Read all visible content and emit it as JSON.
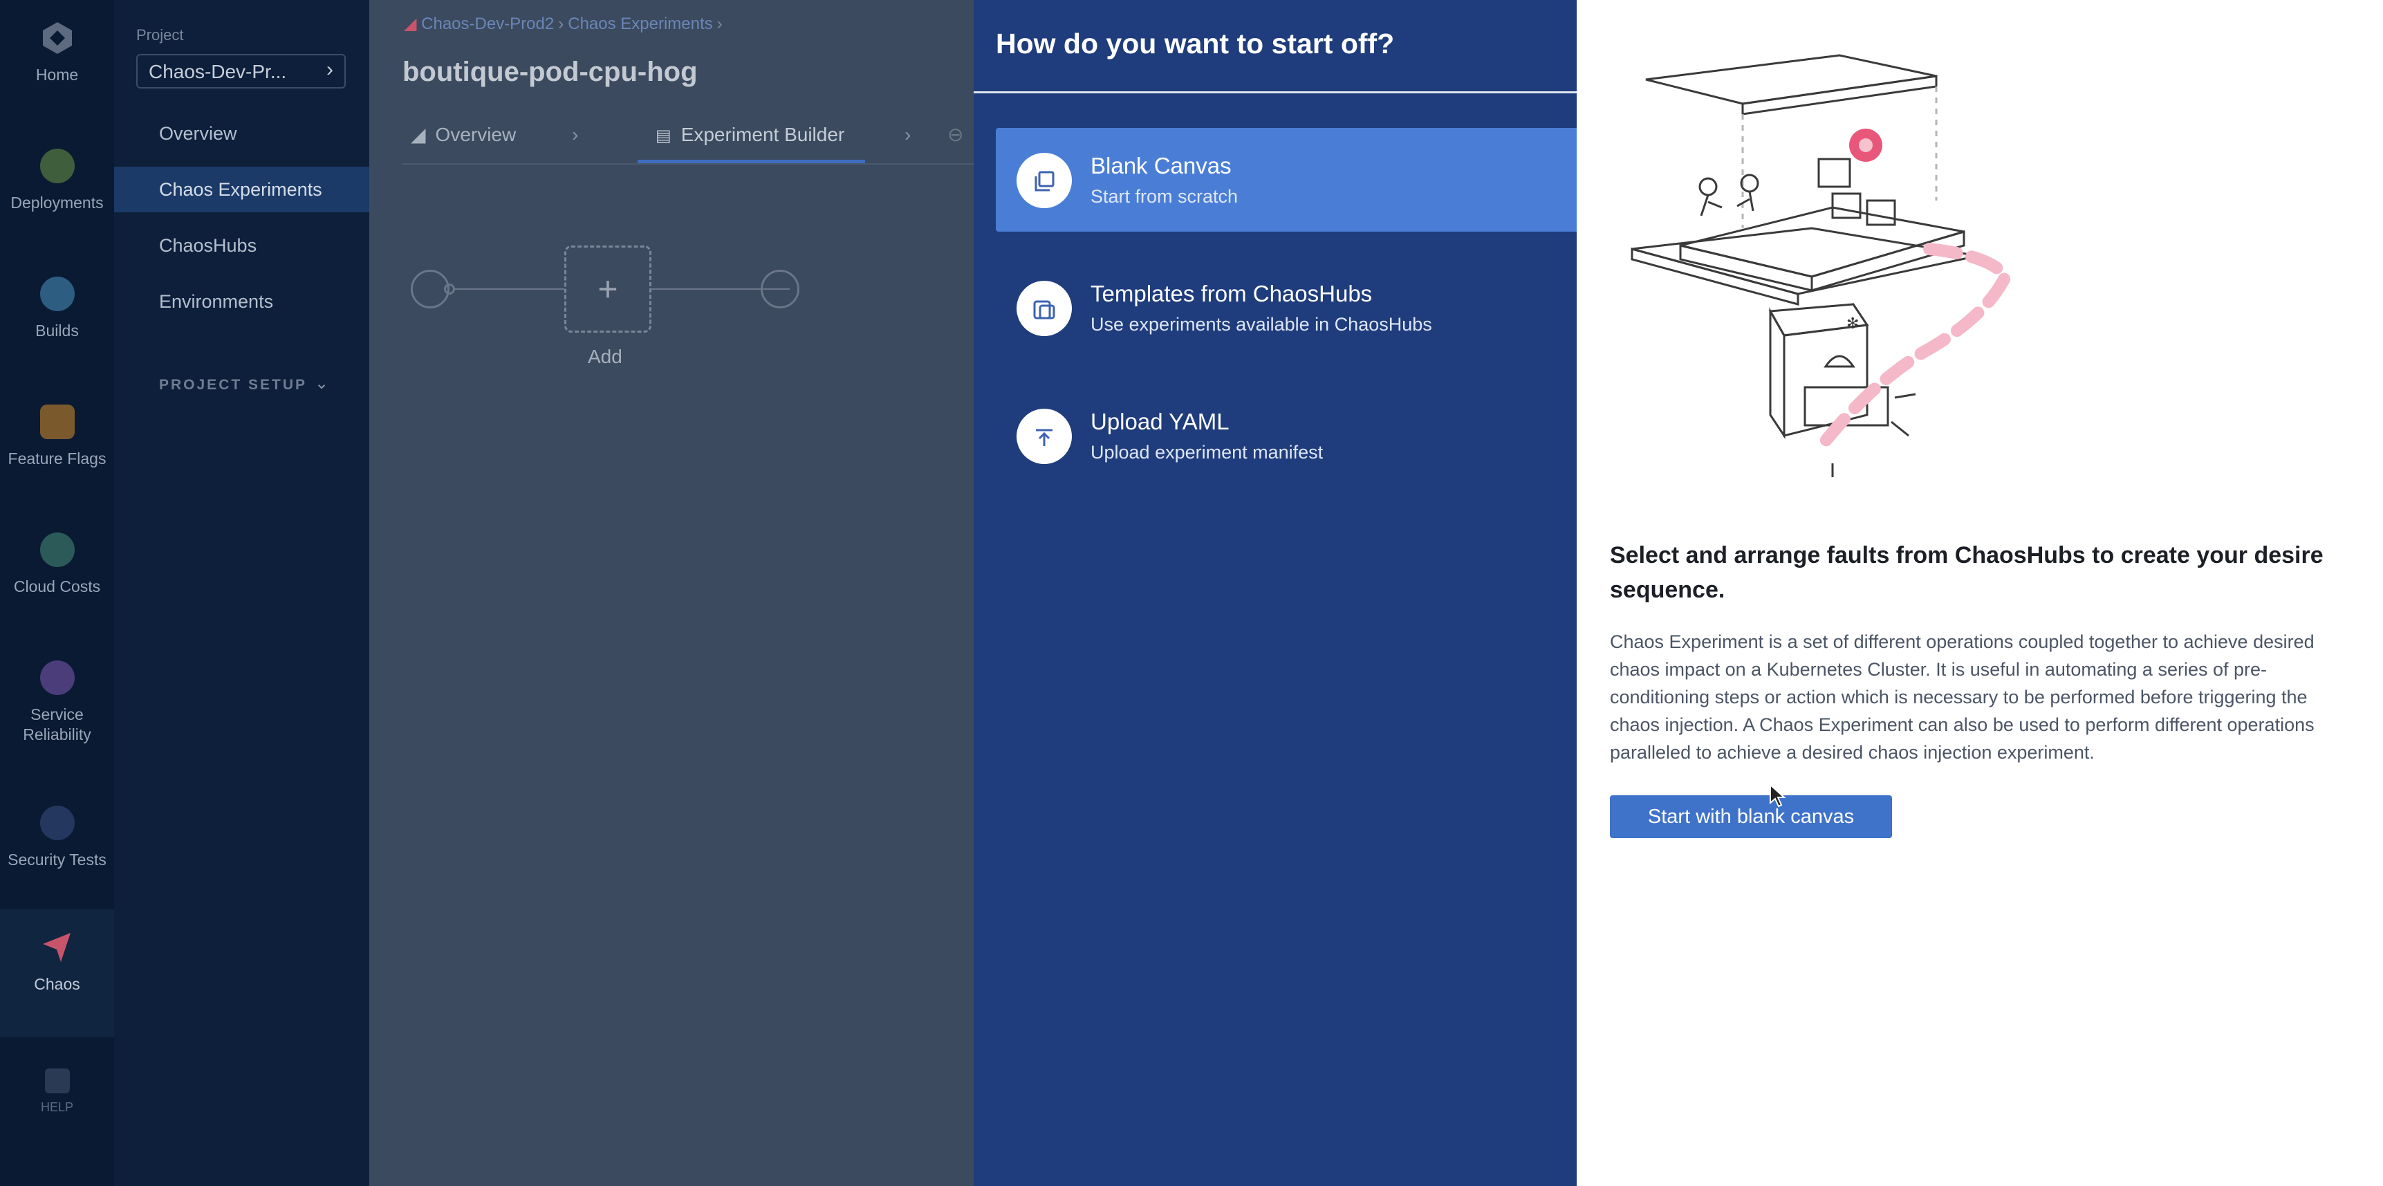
{
  "app_nav": {
    "items": [
      {
        "label": "Home",
        "icon": "home-icon"
      },
      {
        "label": "Deployments",
        "icon": "deployments-icon"
      },
      {
        "label": "Builds",
        "icon": "builds-icon"
      },
      {
        "label": "Feature Flags",
        "icon": "feature-flags-icon"
      },
      {
        "label": "Cloud Costs",
        "icon": "cloud-costs-icon"
      },
      {
        "label": "Service Reliability",
        "icon": "service-reliability-icon"
      },
      {
        "label": "Security Tests",
        "icon": "security-tests-icon"
      },
      {
        "label": "Chaos",
        "icon": "chaos-icon"
      },
      {
        "label": "HELP",
        "icon": "help-icon"
      }
    ]
  },
  "project_nav": {
    "project_label": "Project",
    "project_name": "Chaos-Dev-Pr...",
    "items": [
      {
        "label": "Overview"
      },
      {
        "label": "Chaos Experiments"
      },
      {
        "label": "ChaosHubs"
      },
      {
        "label": "Environments"
      }
    ],
    "setup_label": "PROJECT SETUP"
  },
  "main": {
    "breadcrumb": [
      "Chaos-Dev-Prod2",
      "Chaos Experiments"
    ],
    "title": "boutique-pod-cpu-hog",
    "tabs": [
      {
        "label": "Overview"
      },
      {
        "label": "Experiment Builder"
      }
    ],
    "add_label": "Add",
    "add_symbol": "+"
  },
  "drawer": {
    "title": "How do you want to start off?",
    "options": [
      {
        "title": "Blank Canvas",
        "subtitle": "Start from scratch",
        "icon": "copy-icon"
      },
      {
        "title": "Templates from ChaosHubs",
        "subtitle": "Use experiments available in ChaosHubs",
        "icon": "template-icon"
      },
      {
        "title": "Upload YAML",
        "subtitle": "Upload experiment manifest",
        "icon": "upload-icon"
      }
    ],
    "detail_heading": "Select and arrange faults from ChaosHubs to create your desire sequence.",
    "detail_body": "Chaos Experiment is a set of different operations coupled together to achieve desired chaos impact on a Kubernetes Cluster. It is useful in automating a series of pre-conditioning steps or action which is necessary to be performed before triggering the chaos injection. A Chaos Experiment can also be used to perform different operations paralleled to achieve a desired chaos injection experiment.",
    "start_button": "Start with blank canvas"
  },
  "colors": {
    "drawer_blue": "#1f3c7c",
    "selected_option": "#4a7ed6",
    "primary_button": "#3f72c9",
    "illustration_accent": "#e8577a"
  }
}
